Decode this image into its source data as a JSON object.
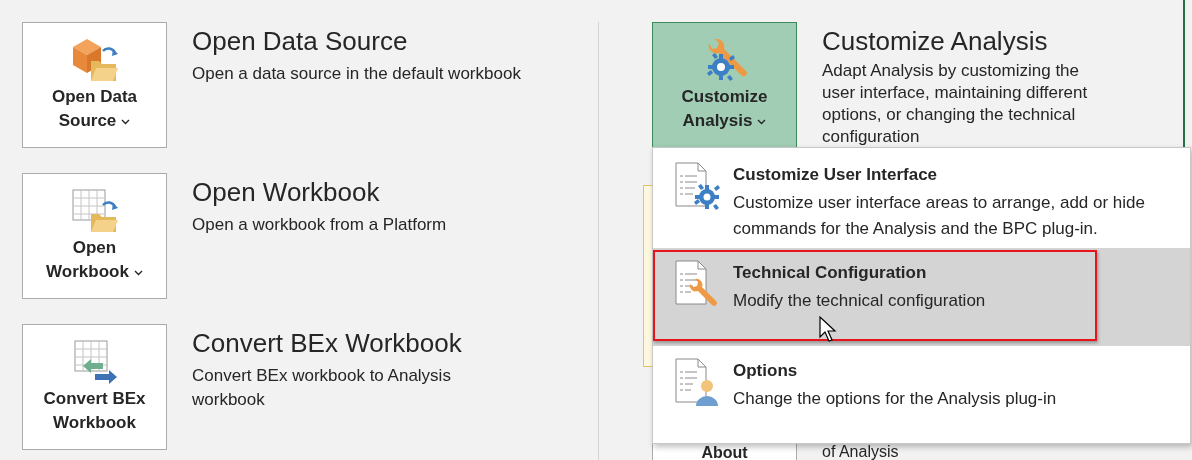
{
  "left_actions": [
    {
      "label": "Open Data\nSource",
      "has_menu": true,
      "selected": false,
      "title": "Open Data Source",
      "description": "Open a data source in the default workbook"
    },
    {
      "label": "Open\nWorkbook",
      "has_menu": true,
      "selected": false,
      "title": "Open Workbook",
      "description": "Open a workbook from a Platform"
    },
    {
      "label": "Convert BEx\nWorkbook",
      "has_menu": false,
      "selected": false,
      "title": "Convert BEx Workbook",
      "description": "Convert BEx workbook to Analysis workbook"
    }
  ],
  "right_actions": [
    {
      "label": "Customize\nAnalysis",
      "has_menu": true,
      "selected": true,
      "title": "Customize Analysis",
      "description": "Adapt Analysis by customizing the user interface, maintaining different options, or changing the technical configuration"
    },
    {
      "label": "About",
      "has_menu": false,
      "selected": false,
      "description": "of Analysis"
    }
  ],
  "menu": {
    "items": [
      {
        "title": "Customize User Interface",
        "description": "Customize user interface areas to arrange, add or hide commands for the Analysis and the BPC plug-in.",
        "highlighted": false,
        "outlined": false
      },
      {
        "title": "Technical Configuration",
        "description": "Modify the technical configuration",
        "highlighted": true,
        "outlined": true
      },
      {
        "title": "Options",
        "description": "Change the options for the Analysis plug-in",
        "highlighted": false,
        "outlined": false
      }
    ]
  }
}
